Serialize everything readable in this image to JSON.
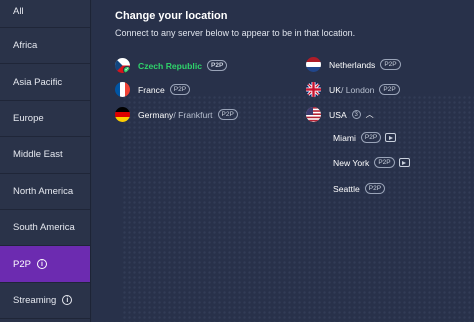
{
  "sidebar": {
    "items": [
      {
        "label": "All"
      },
      {
        "label": "Africa"
      },
      {
        "label": "Asia Pacific"
      },
      {
        "label": "Europe"
      },
      {
        "label": "Middle East"
      },
      {
        "label": "North America"
      },
      {
        "label": "South America"
      },
      {
        "label": "P2P",
        "active": true
      },
      {
        "label": "Streaming"
      }
    ]
  },
  "main": {
    "title": "Change your location",
    "subtitle": "Connect to any server below to appear to be in that location.",
    "p2p_badge": "P2P",
    "left_servers": [
      {
        "name": "Czech Republic",
        "connected": true
      },
      {
        "name": "France"
      },
      {
        "name": "Germany",
        "city": " / Frankfurt"
      }
    ],
    "right_servers": [
      {
        "name": "Netherlands"
      },
      {
        "name": "UK",
        "city": " / London"
      },
      {
        "name": "USA",
        "count": "3"
      }
    ],
    "usa_cities": [
      {
        "name": "Miami",
        "streaming": true
      },
      {
        "name": "New York",
        "streaming": true
      },
      {
        "name": "Seattle",
        "streaming": false
      }
    ]
  },
  "colors": {
    "active": "#6c2bb0",
    "connected": "#2fd36b",
    "background": "#28314a"
  }
}
